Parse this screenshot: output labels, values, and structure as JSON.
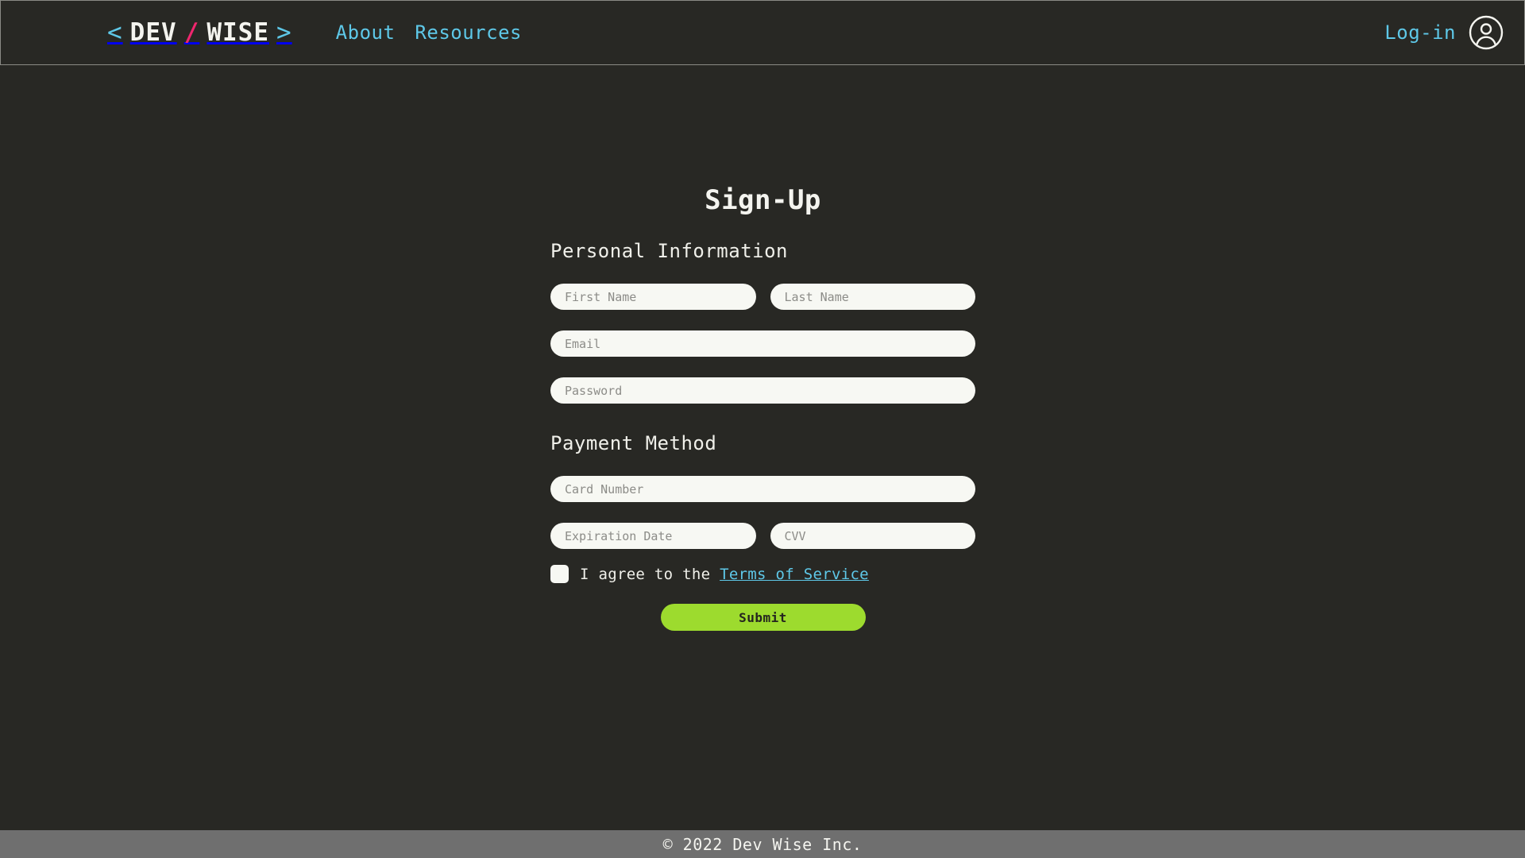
{
  "header": {
    "brand": {
      "open_bracket": "<",
      "word1": "DEV",
      "slash": "/",
      "word2": "WISE",
      "close_bracket": ">",
      "bracket_color": "#5ec8e8",
      "word_color": "#f4f4ef",
      "slash_color": "#f0266e"
    },
    "nav": [
      {
        "label": "About"
      },
      {
        "label": "Resources"
      }
    ],
    "login_label": "Log-in",
    "avatar_icon": "user-circle-icon",
    "link_color": "#5ec8e8"
  },
  "main": {
    "title": "Sign-Up",
    "sections": [
      {
        "label": "Personal Information"
      },
      {
        "label": "Payment Method"
      }
    ],
    "fields": {
      "first_name": {
        "placeholder": "First Name",
        "value": ""
      },
      "last_name": {
        "placeholder": "Last Name",
        "value": ""
      },
      "email": {
        "placeholder": "Email",
        "value": ""
      },
      "password": {
        "placeholder": "Password",
        "value": ""
      },
      "card_number": {
        "placeholder": "Card Number",
        "value": ""
      },
      "expiration_date": {
        "placeholder": "Expiration Date",
        "value": ""
      },
      "cvv": {
        "placeholder": "CVV",
        "value": ""
      }
    },
    "terms": {
      "checked": false,
      "prefix": "I agree to the ",
      "link_label": "Terms of Service",
      "link_color": "#5ec8e8"
    },
    "submit_label": "Submit",
    "submit_color": "#9ddb2e"
  },
  "footer": {
    "text": "© 2022 Dev Wise Inc.",
    "background": "#6f6f6f"
  },
  "theme": {
    "page_background": "#282824",
    "input_background": "#f7f8f3",
    "text_color": "#f0f0ea"
  }
}
